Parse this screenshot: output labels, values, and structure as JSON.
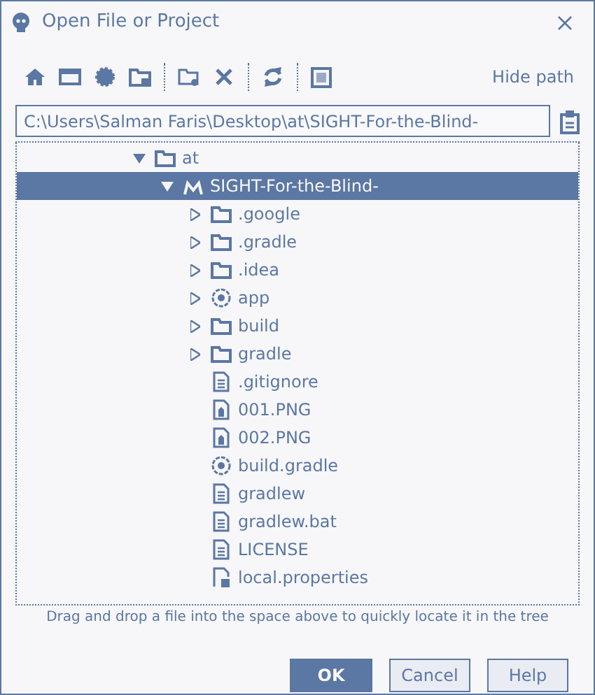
{
  "window": {
    "title": "Open File or Project"
  },
  "toolbar": {
    "hide_path": "Hide path"
  },
  "path_field": {
    "value": "C:\\Users\\Salman Faris\\Desktop\\at\\SIGHT-For-the-Blind-"
  },
  "tree": [
    {
      "label": "at",
      "kind": "folder",
      "expanded": true,
      "selected": false,
      "children": [
        {
          "label": "SIGHT-For-the-Blind-",
          "kind": "project",
          "expanded": true,
          "selected": true,
          "children": [
            {
              "label": ".google",
              "kind": "folder",
              "expanded": false,
              "selected": false
            },
            {
              "label": ".gradle",
              "kind": "folder",
              "expanded": false,
              "selected": false
            },
            {
              "label": ".idea",
              "kind": "folder",
              "expanded": false,
              "selected": false
            },
            {
              "label": "app",
              "kind": "module",
              "expanded": false,
              "selected": false
            },
            {
              "label": "build",
              "kind": "folder",
              "expanded": false,
              "selected": false
            },
            {
              "label": "gradle",
              "kind": "folder",
              "expanded": false,
              "selected": false
            },
            {
              "label": ".gitignore",
              "kind": "file",
              "selected": false
            },
            {
              "label": "001.PNG",
              "kind": "image",
              "selected": false
            },
            {
              "label": "002.PNG",
              "kind": "image",
              "selected": false
            },
            {
              "label": "build.gradle",
              "kind": "module",
              "selected": false
            },
            {
              "label": "gradlew",
              "kind": "file",
              "selected": false
            },
            {
              "label": "gradlew.bat",
              "kind": "file",
              "selected": false
            },
            {
              "label": "LICENSE",
              "kind": "file",
              "selected": false
            },
            {
              "label": "local.properties",
              "kind": "properties",
              "selected": false
            }
          ]
        }
      ]
    }
  ],
  "hint": "Drag and drop a file into the space above to quickly locate it in the tree",
  "buttons": [
    {
      "label": "OK",
      "kind": "primary"
    },
    {
      "label": "Cancel",
      "kind": "secondary"
    },
    {
      "label": "Help",
      "kind": "secondary"
    }
  ]
}
